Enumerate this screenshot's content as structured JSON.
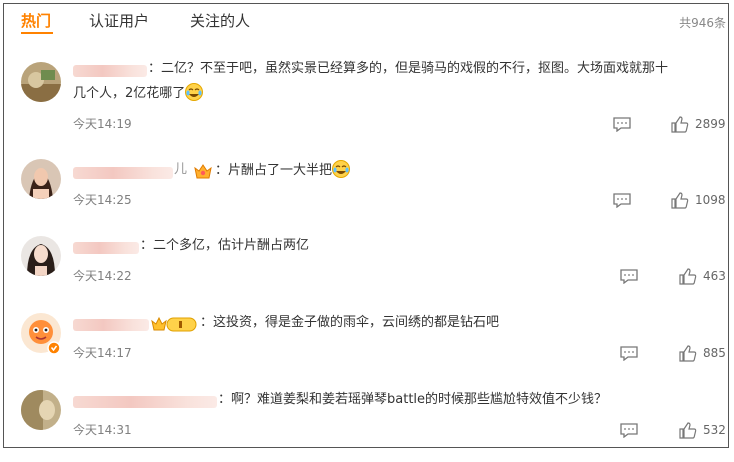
{
  "tabs": [
    {
      "label": "热门",
      "active": true
    },
    {
      "label": "认证用户",
      "active": false
    },
    {
      "label": "关注的人",
      "active": false
    }
  ],
  "total_label": "共946条",
  "comments": [
    {
      "text_line1": "：二亿？不至于吧，虽然实景已经算多的，但是骑马的戏假的不行，抠图。大场面戏就那十",
      "text_line2": "几个人，2亿花哪了",
      "emoji": "laugh-cry-emoji",
      "time": "今天14:19",
      "likes": "2899"
    },
    {
      "name_tail": "儿",
      "text_line1": "：片酬占了一大半把",
      "emoji": "laugh-cry-emoji",
      "time": "今天14:25",
      "likes": "1098"
    },
    {
      "text_line1": "：二个多亿，估计片酬占两亿",
      "time": "今天14:22",
      "likes": "463"
    },
    {
      "text_line1": "：这投资，得是金子做的雨伞，云间绣的都是钻石吧",
      "time": "今天14:17",
      "likes": "885"
    },
    {
      "text_line1": "：啊？难道姜梨和姜若瑶弹琴battle的时候那些尴尬特效值不少钱？",
      "time": "今天14:31",
      "likes": "532"
    }
  ],
  "colors": {
    "accent": "#ff8200",
    "text": "#333333",
    "muted": "#808080"
  }
}
